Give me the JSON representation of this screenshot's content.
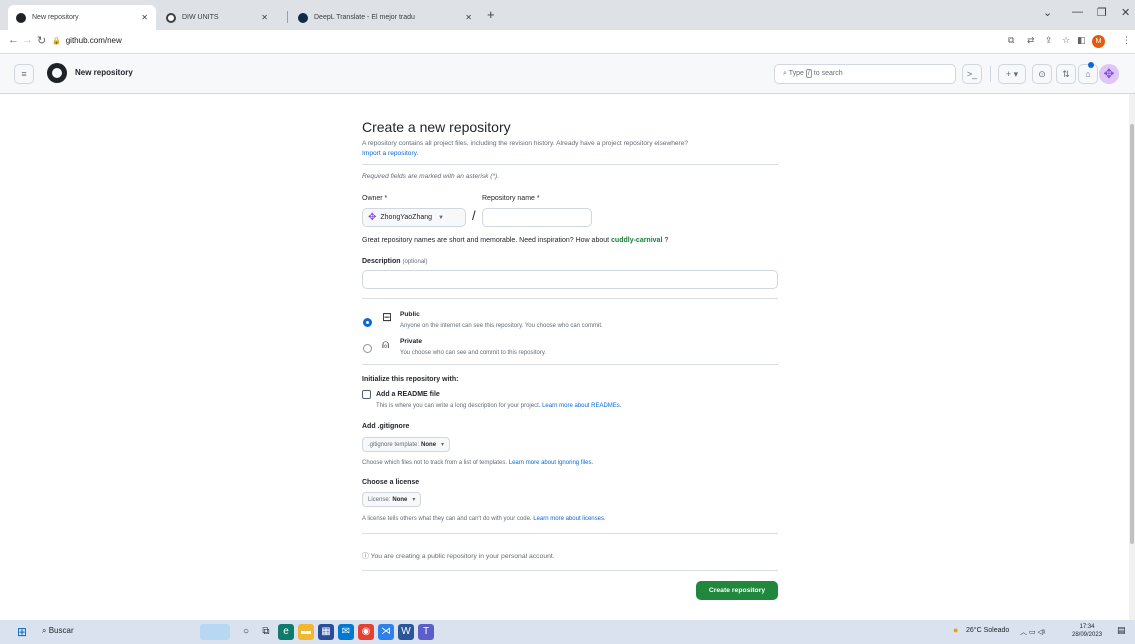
{
  "browser": {
    "tabs": [
      {
        "title": "New repository",
        "active": true
      },
      {
        "title": "DIW UNITS",
        "active": false
      },
      {
        "title": "DeepL Translate - El mejor tradu",
        "active": false
      }
    ],
    "url": "github.com/new",
    "profile_initial": "M"
  },
  "header": {
    "title": "New repository",
    "search_placeholder_pre": "Type",
    "search_key": "/",
    "search_placeholder_post": "to search"
  },
  "page": {
    "title": "Create a new repository",
    "intro": "A repository contains all project files, including the revision history. Already have a project repository elsewhere?",
    "import_link": "Import a repository.",
    "required_note": "Required fields are marked with an asterisk (*).",
    "owner_label": "Owner *",
    "owner_value": "ZhongYaoZhang",
    "repo_name_label": "Repository name *",
    "repo_name_value": "",
    "slash": "/",
    "suggest_pre": "Great repository names are short and memorable. Need inspiration? How about",
    "suggest_name": "cuddly-carnival",
    "suggest_post": "?",
    "description_label": "Description",
    "description_optional": "(optional)",
    "description_value": "",
    "visibility": [
      {
        "title": "Public",
        "desc": "Anyone on the internet can see this repository. You choose who can commit.",
        "selected": true
      },
      {
        "title": "Private",
        "desc": "You choose who can see and commit to this repository.",
        "selected": false
      }
    ],
    "init_heading": "Initialize this repository with:",
    "readme_label": "Add a README file",
    "readme_checked": false,
    "readme_desc": "This is where you can write a long description for your project.",
    "readme_link": "Learn more about READMEs.",
    "gitignore_heading": "Add .gitignore",
    "gitignore_select_label": ".gitignore template:",
    "gitignore_select_value": "None",
    "gitignore_desc": "Choose which files not to track from a list of templates.",
    "gitignore_link": "Learn more about ignoring files.",
    "license_heading": "Choose a license",
    "license_select_label": "License:",
    "license_select_value": "None",
    "license_desc": "A license tells others what they can and can't do with your code.",
    "license_link": "Learn more about licenses.",
    "info_icon": "ⓘ",
    "info_text": "You are creating a public repository in your personal account.",
    "create_button": "Create repository"
  },
  "taskbar": {
    "search_label": "Buscar",
    "weather": "26°C  Soleado",
    "time": "17:34",
    "date": "28/09/2023"
  },
  "colors": {
    "primary_button": "#1f883d",
    "link": "#0969da",
    "suggestion": "#1a7f37"
  }
}
